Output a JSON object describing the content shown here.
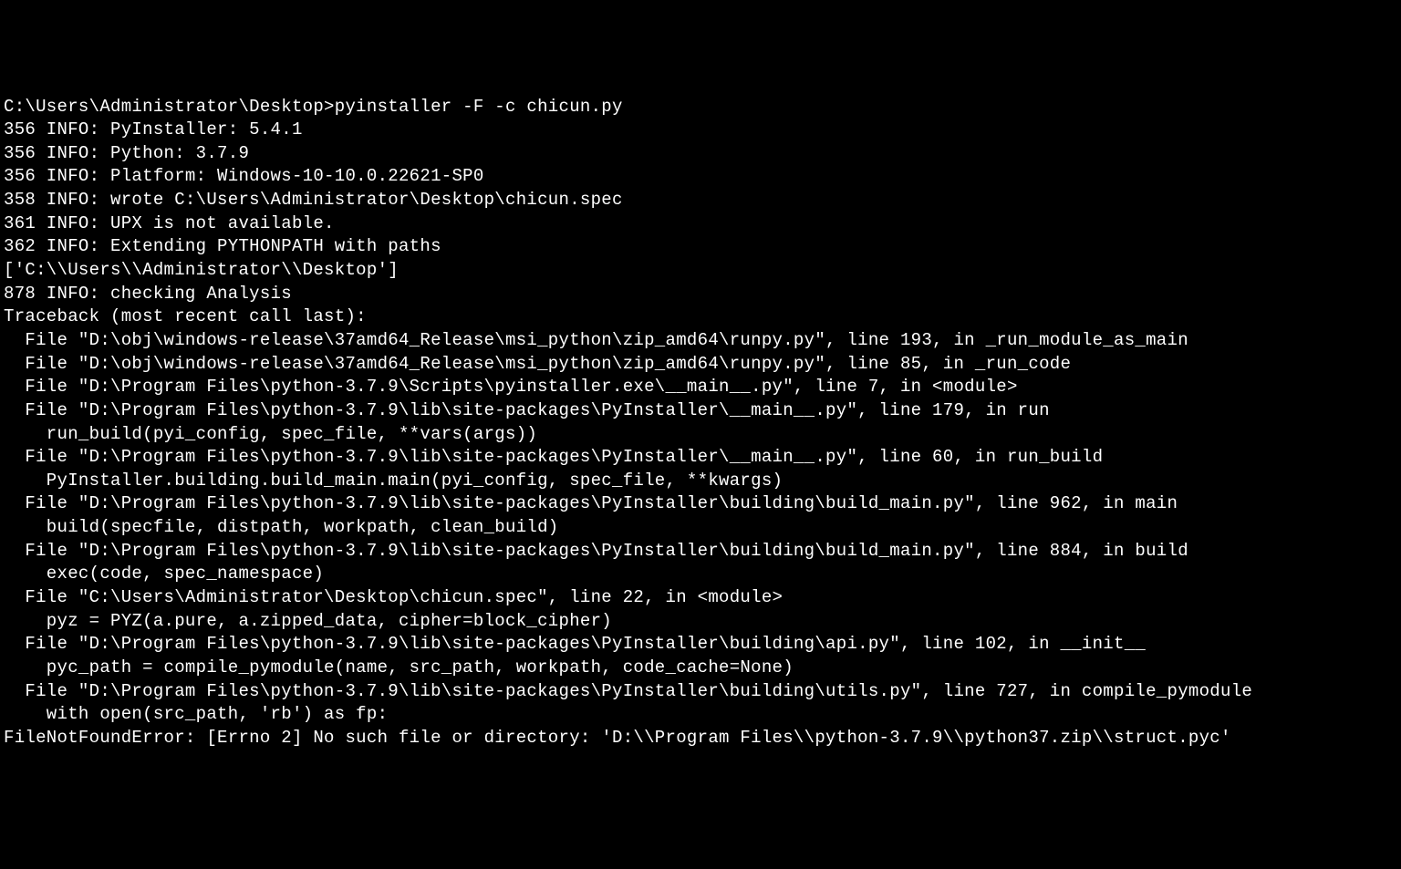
{
  "terminal": {
    "lines": [
      "C:\\Users\\Administrator\\Desktop>pyinstaller -F -c chicun.py",
      "356 INFO: PyInstaller: 5.4.1",
      "356 INFO: Python: 3.7.9",
      "356 INFO: Platform: Windows-10-10.0.22621-SP0",
      "358 INFO: wrote C:\\Users\\Administrator\\Desktop\\chicun.spec",
      "361 INFO: UPX is not available.",
      "362 INFO: Extending PYTHONPATH with paths",
      "['C:\\\\Users\\\\Administrator\\\\Desktop']",
      "878 INFO: checking Analysis",
      "Traceback (most recent call last):",
      "  File \"D:\\obj\\windows-release\\37amd64_Release\\msi_python\\zip_amd64\\runpy.py\", line 193, in _run_module_as_main",
      "  File \"D:\\obj\\windows-release\\37amd64_Release\\msi_python\\zip_amd64\\runpy.py\", line 85, in _run_code",
      "  File \"D:\\Program Files\\python-3.7.9\\Scripts\\pyinstaller.exe\\__main__.py\", line 7, in <module>",
      "  File \"D:\\Program Files\\python-3.7.9\\lib\\site-packages\\PyInstaller\\__main__.py\", line 179, in run",
      "    run_build(pyi_config, spec_file, **vars(args))",
      "  File \"D:\\Program Files\\python-3.7.9\\lib\\site-packages\\PyInstaller\\__main__.py\", line 60, in run_build",
      "    PyInstaller.building.build_main.main(pyi_config, spec_file, **kwargs)",
      "  File \"D:\\Program Files\\python-3.7.9\\lib\\site-packages\\PyInstaller\\building\\build_main.py\", line 962, in main",
      "    build(specfile, distpath, workpath, clean_build)",
      "  File \"D:\\Program Files\\python-3.7.9\\lib\\site-packages\\PyInstaller\\building\\build_main.py\", line 884, in build",
      "    exec(code, spec_namespace)",
      "  File \"C:\\Users\\Administrator\\Desktop\\chicun.spec\", line 22, in <module>",
      "    pyz = PYZ(a.pure, a.zipped_data, cipher=block_cipher)",
      "  File \"D:\\Program Files\\python-3.7.9\\lib\\site-packages\\PyInstaller\\building\\api.py\", line 102, in __init__",
      "    pyc_path = compile_pymodule(name, src_path, workpath, code_cache=None)",
      "  File \"D:\\Program Files\\python-3.7.9\\lib\\site-packages\\PyInstaller\\building\\utils.py\", line 727, in compile_pymodule",
      "    with open(src_path, 'rb') as fp:",
      "FileNotFoundError: [Errno 2] No such file or directory: 'D:\\\\Program Files\\\\python-3.7.9\\\\python37.zip\\\\struct.pyc'"
    ]
  }
}
